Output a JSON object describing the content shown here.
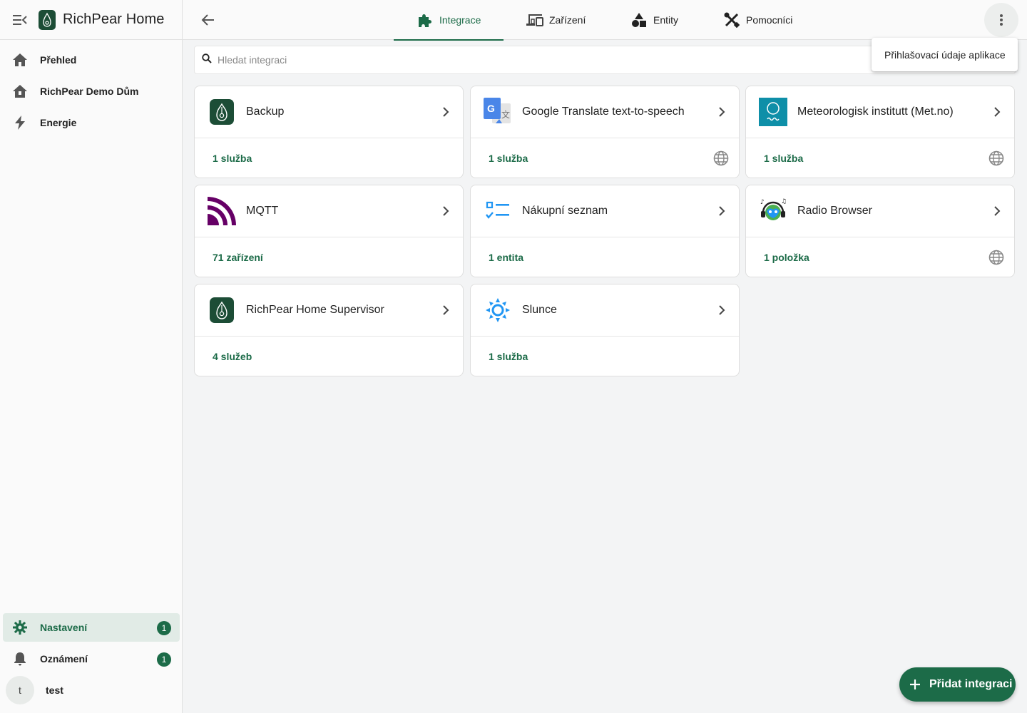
{
  "app": {
    "title": "RichPear Home"
  },
  "sidebar": {
    "items": [
      {
        "label": "Přehled",
        "icon": "home-icon"
      },
      {
        "label": "RichPear Demo Dům",
        "icon": "home-outline-icon"
      },
      {
        "label": "Energie",
        "icon": "lightning-icon"
      }
    ],
    "bottom": [
      {
        "label": "Nastavení",
        "icon": "gear-icon",
        "badge": "1"
      },
      {
        "label": "Oznámení",
        "icon": "bell-icon",
        "badge": "1"
      }
    ],
    "user": {
      "initial": "t",
      "name": "test"
    }
  },
  "topbar": {
    "tabs": [
      {
        "label": "Integrace",
        "icon": "puzzle-icon"
      },
      {
        "label": "Zařízení",
        "icon": "devices-icon"
      },
      {
        "label": "Entity",
        "icon": "shapes-icon"
      },
      {
        "label": "Pomocníci",
        "icon": "tools-icon"
      }
    ]
  },
  "search": {
    "placeholder": "Hledat integraci",
    "value": ""
  },
  "overflow_menu": {
    "item": "Přihlašovací údaje aplikace"
  },
  "integrations": [
    {
      "title": "Backup",
      "link": "1 služba",
      "logo": "richpear-logo",
      "cloud": false
    },
    {
      "title": "Google Translate text-to-speech",
      "link": "1 služba",
      "logo": "google-translate-logo",
      "cloud": true
    },
    {
      "title": "Meteorologisk institutt (Met.no)",
      "link": "1 služba",
      "logo": "met-no-logo",
      "cloud": true
    },
    {
      "title": "MQTT",
      "link": "71 zařízení",
      "logo": "mqtt-logo",
      "cloud": false
    },
    {
      "title": "Nákupní seznam",
      "link": "1 entita",
      "logo": "shopping-list-logo",
      "cloud": false
    },
    {
      "title": "Radio Browser",
      "link": "1 položka",
      "logo": "radio-browser-logo",
      "cloud": true
    },
    {
      "title": "RichPear Home Supervisor",
      "link": "4 služeb",
      "logo": "richpear-logo",
      "cloud": false
    },
    {
      "title": "Slunce",
      "link": "1 služba",
      "logo": "sun-logo",
      "cloud": false
    }
  ],
  "fab": {
    "label": "Přidat integraci"
  },
  "colors": {
    "primary": "#1c6b48",
    "sidebar_active_bg": "#e1ebe6",
    "mqtt": "#660066",
    "met_no": "#0e8fa8",
    "sun": "#2196f3"
  }
}
